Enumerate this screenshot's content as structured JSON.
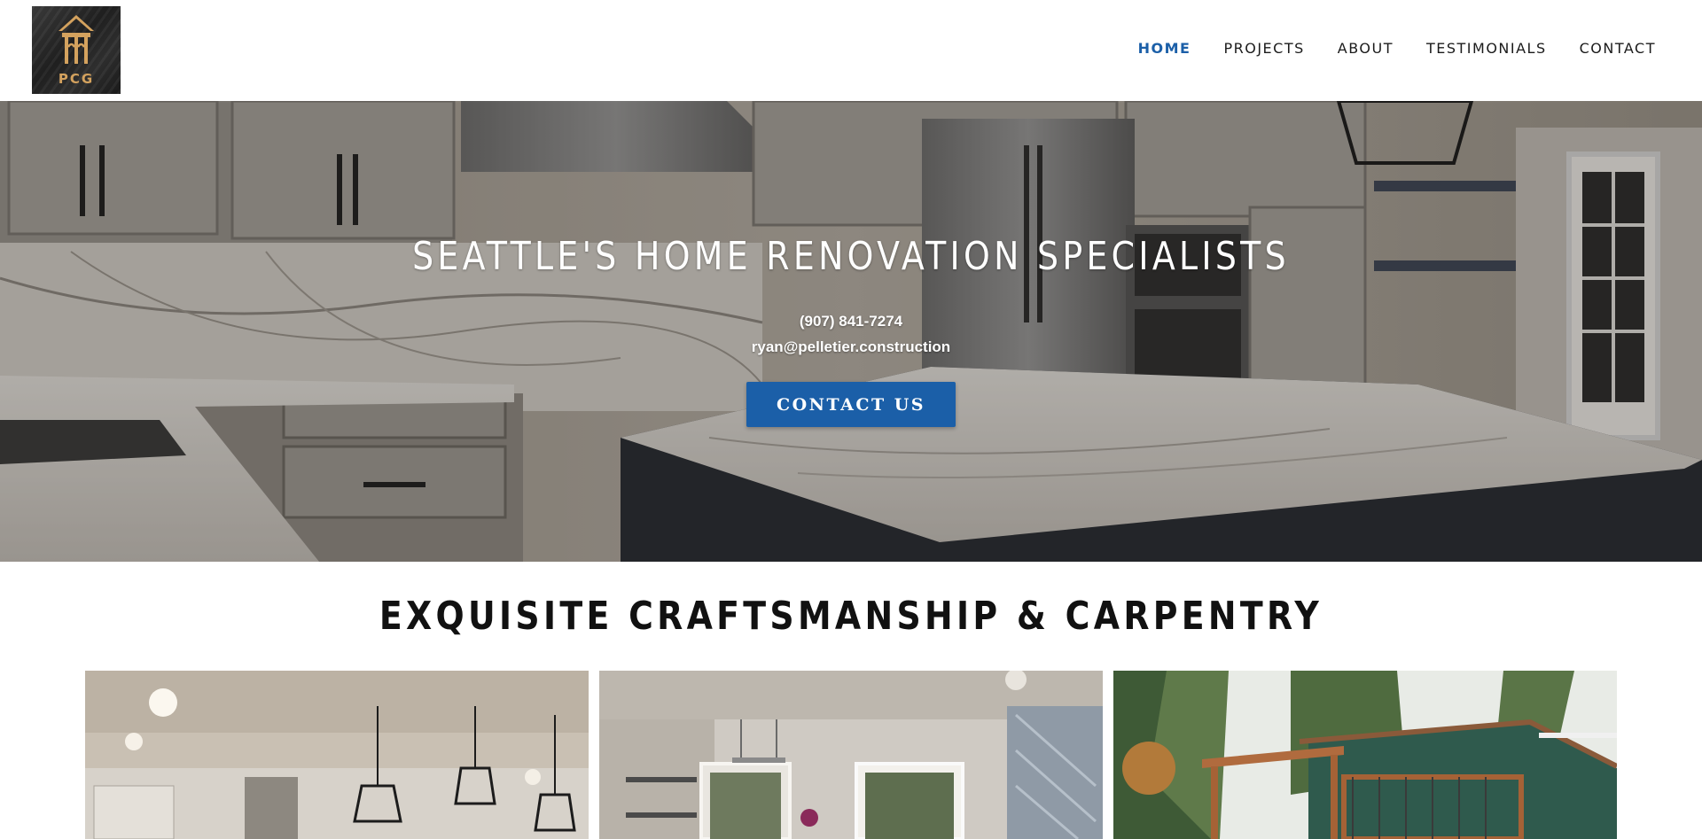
{
  "header": {
    "logo_text": "PCG",
    "nav": [
      {
        "label": "HOME",
        "active": true
      },
      {
        "label": "PROJECTS",
        "active": false
      },
      {
        "label": "ABOUT",
        "active": false
      },
      {
        "label": "TESTIMONIALS",
        "active": false
      },
      {
        "label": "CONTACT",
        "active": false
      }
    ]
  },
  "hero": {
    "title": "SEATTLE'S HOME RENOVATION SPECIALISTS",
    "phone": "(907) 841-7274",
    "email": "ryan@pelletier.construction",
    "cta_label": "CONTACT US"
  },
  "section": {
    "title": "EXQUISITE CRAFTSMANSHIP & CARPENTRY",
    "gallery": [
      "kitchen-pendant-lights-photo",
      "dining-room-photo",
      "exterior-deck-photo"
    ]
  },
  "colors": {
    "accent": "#1b5fa8",
    "logo_gold": "#d4a25e",
    "logo_bg": "#2a2a2a"
  }
}
